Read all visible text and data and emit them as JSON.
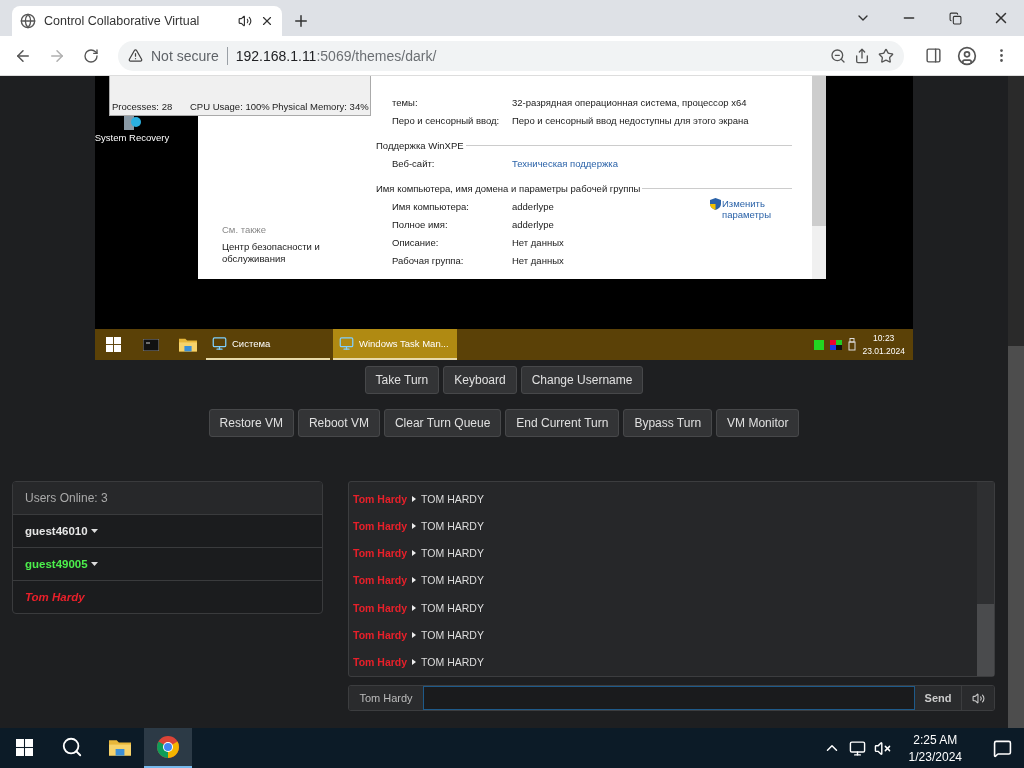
{
  "browser": {
    "tab": {
      "title": "Control Collaborative Virtual",
      "audio": true
    },
    "address": {
      "security": "Not secure",
      "host": "192.168.1.11",
      "path": ":5069/themes/dark/"
    }
  },
  "vm_screen": {
    "task_manager": {
      "status": [
        "Processes: 28",
        "CPU Usage: 100%",
        "Physical Memory: 34%"
      ]
    },
    "desktop_icons": [
      {
        "label": "System Recovery"
      }
    ],
    "system_window": {
      "rows": [
        {
          "label": "темы:",
          "value": "32-разрядная операционная система, процессор x64"
        },
        {
          "label": "Перо и сенсорный ввод:",
          "value": "Перо и сенсорный ввод недоступны для этого экрана"
        }
      ],
      "sections": [
        {
          "heading": "Поддержка WinXPE",
          "rows": [
            {
              "label": "Веб-сайт:",
              "value": "Техническая поддержка",
              "kind": "link"
            }
          ]
        },
        {
          "heading": "Имя компьютера, имя домена и параметры рабочей группы",
          "action": "Изменить параметры",
          "rows": [
            {
              "label": "Имя компьютера:",
              "value": "adderlype",
              "kind": "text"
            },
            {
              "label": "Полное имя:",
              "value": "adderlype",
              "kind": "text"
            },
            {
              "label": "Описание:",
              "value": "Нет данных",
              "kind": "text"
            },
            {
              "label": "Рабочая группа:",
              "value": "Нет данных",
              "kind": "text"
            }
          ]
        }
      ],
      "see_also": {
        "heading": "См. также",
        "link": "Центр безопасности и обслуживания"
      }
    },
    "taskbar": {
      "items": [
        {
          "kind": "start"
        },
        {
          "kind": "console"
        },
        {
          "kind": "folder"
        },
        {
          "kind": "task",
          "label": "Система",
          "selected": false
        },
        {
          "kind": "task",
          "label": "Windows Task Man...",
          "selected": true
        }
      ],
      "time": "10:23",
      "date": "23.01.2024"
    }
  },
  "turn_buttons": [
    "Take Turn",
    "Keyboard",
    "Change Username"
  ],
  "admin_buttons": [
    "Restore VM",
    "Reboot VM",
    "Clear Turn Queue",
    "End Current Turn",
    "Bypass Turn",
    "VM Monitor"
  ],
  "users": {
    "header": "Users Online: 3",
    "items": [
      {
        "name": "guest46010",
        "color": "#e6e6e6",
        "menu": true,
        "self": false
      },
      {
        "name": "guest49005",
        "color": "#4cf04c",
        "menu": true,
        "self": false
      },
      {
        "name": "Tom Hardy",
        "color": "#e8202a",
        "menu": false,
        "self": true
      }
    ]
  },
  "chat": {
    "messages": [
      {
        "user": "Tom Hardy",
        "text": "TOM HARDY"
      },
      {
        "user": "Tom Hardy",
        "text": "TOM HARDY"
      },
      {
        "user": "Tom Hardy",
        "text": "TOM HARDY"
      },
      {
        "user": "Tom Hardy",
        "text": "TOM HARDY"
      },
      {
        "user": "Tom Hardy",
        "text": "TOM HARDY"
      },
      {
        "user": "Tom Hardy",
        "text": "TOM HARDY"
      },
      {
        "user": "Tom Hardy",
        "text": "TOM HARDY"
      }
    ],
    "username": "Tom Hardy",
    "send": "Send"
  },
  "taskbar": {
    "items": [
      {
        "kind": "start",
        "selected": false
      },
      {
        "kind": "search",
        "selected": false
      },
      {
        "kind": "folder",
        "selected": false
      },
      {
        "kind": "browser",
        "selected": true
      }
    ],
    "time": "2:25 AM",
    "date": "1/23/2024"
  }
}
